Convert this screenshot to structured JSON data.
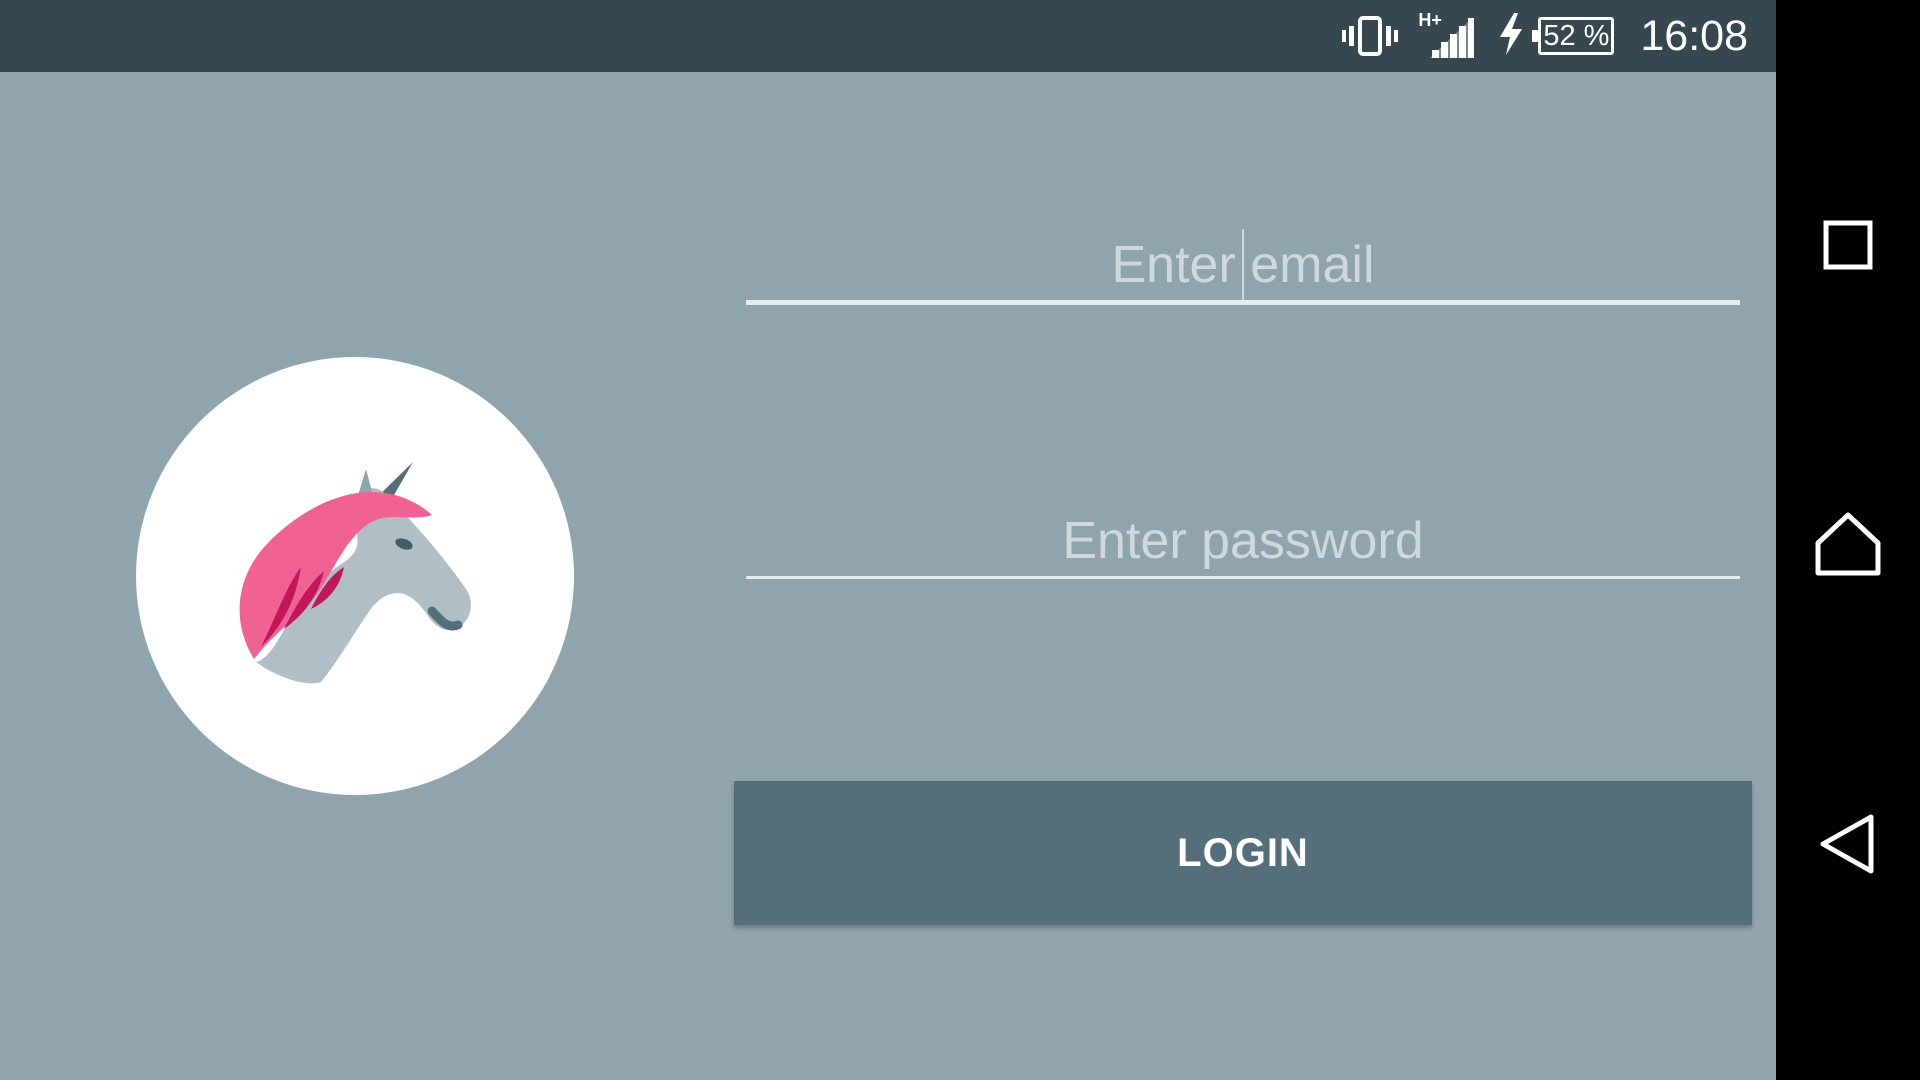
{
  "status_bar": {
    "network_type": "H+",
    "battery_level": "52 %",
    "time": "16:08",
    "icons": [
      "vibrate-icon",
      "cellular-signal-icon",
      "charging-bolt-icon",
      "battery-icon"
    ]
  },
  "logo": {
    "icon": "unicorn-icon",
    "colors": {
      "circle": "#ffffff",
      "mane": "#f06292",
      "mane_dark": "#c2185b",
      "head": "#b0bec5",
      "horn": "#546e7a"
    }
  },
  "form": {
    "email_placeholder": "Enter email",
    "email_value": "",
    "password_placeholder": "Enter password",
    "password_value": "",
    "login_label": "LOGIN"
  },
  "nav_bar": {
    "buttons": [
      "recent-apps",
      "home",
      "back"
    ]
  },
  "colors": {
    "background": "#90a4ae",
    "status_bar": "#37474f",
    "button": "#546e7a",
    "hint_text": "#cfd8dc",
    "underline": "#e6ebee",
    "nav_bar": "#000000"
  }
}
